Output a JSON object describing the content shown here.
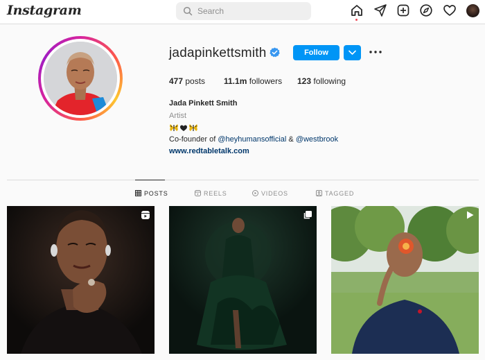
{
  "header": {
    "logo": "Instagram",
    "search_placeholder": "Search",
    "nav_icons": [
      "home-icon",
      "direct-send-icon",
      "new-post-icon",
      "explore-compass-icon",
      "activity-heart-icon",
      "profile-avatar"
    ]
  },
  "profile": {
    "username": "jadapinkettsmith",
    "verified": true,
    "follow_label": "Follow",
    "stats": {
      "posts_count": "477",
      "posts_label": "posts",
      "followers_count": "11.1m",
      "followers_label": "followers",
      "following_count": "123",
      "following_label": "following"
    },
    "full_name": "Jada Pinkett Smith",
    "category": "Artist",
    "bio_prefix": "Co-founder of ",
    "mention_1": "@heyhumansofficial",
    "bio_amp": " & ",
    "mention_2": "@westbrook",
    "website": "www.redtabletalk.com"
  },
  "tabs": [
    {
      "label": "POSTS",
      "active": true
    },
    {
      "label": "REELS",
      "active": false
    },
    {
      "label": "VIDEOS",
      "active": false
    },
    {
      "label": "TAGGED",
      "active": false
    }
  ],
  "posts": [
    {
      "type_icon": "reel-icon"
    },
    {
      "type_icon": "carousel-icon"
    },
    {
      "type_icon": "video-icon"
    }
  ],
  "colors": {
    "accent": "#0095f6",
    "link": "#00376b",
    "notification_dot": "#ed4956"
  }
}
